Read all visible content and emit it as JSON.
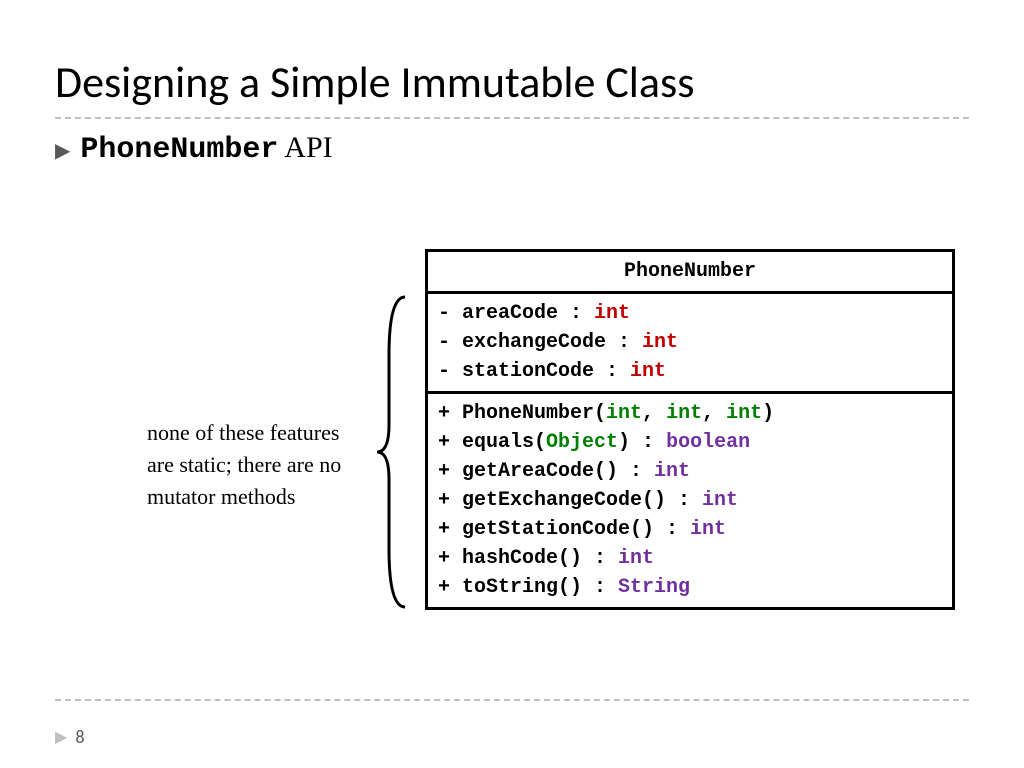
{
  "slide": {
    "title": "Designing a Simple Immutable Class",
    "page_number": "8"
  },
  "bullet": {
    "class_name": "PhoneNumber",
    "api_label": " API"
  },
  "note": {
    "text": "none of these features are static; there are no mutator methods"
  },
  "uml": {
    "class_name": "PhoneNumber",
    "attributes": [
      {
        "prefix": "- areaCode : ",
        "type": "int"
      },
      {
        "prefix": "- exchangeCode : ",
        "type": "int"
      },
      {
        "prefix": "- stationCode : ",
        "type": "int"
      }
    ],
    "methods": {
      "m0": {
        "p1": "+ PhoneNumber(",
        "p2": "int",
        "p3": ", ",
        "p4": "int",
        "p5": ", ",
        "p6": "int",
        "p7": ")"
      },
      "m1": {
        "p1": "+ equals(",
        "p2": "Object",
        "p3": ") : ",
        "ret": "boolean"
      },
      "m2": {
        "p1": "+ getAreaCode() : ",
        "ret": "int"
      },
      "m3": {
        "p1": "+ getExchangeCode() : ",
        "ret": "int"
      },
      "m4": {
        "p1": "+ getStationCode() : ",
        "ret": "int"
      },
      "m5": {
        "p1": "+ hashCode() : ",
        "ret": "int"
      },
      "m6": {
        "p1": "+ toString() : ",
        "ret": "String"
      }
    }
  }
}
